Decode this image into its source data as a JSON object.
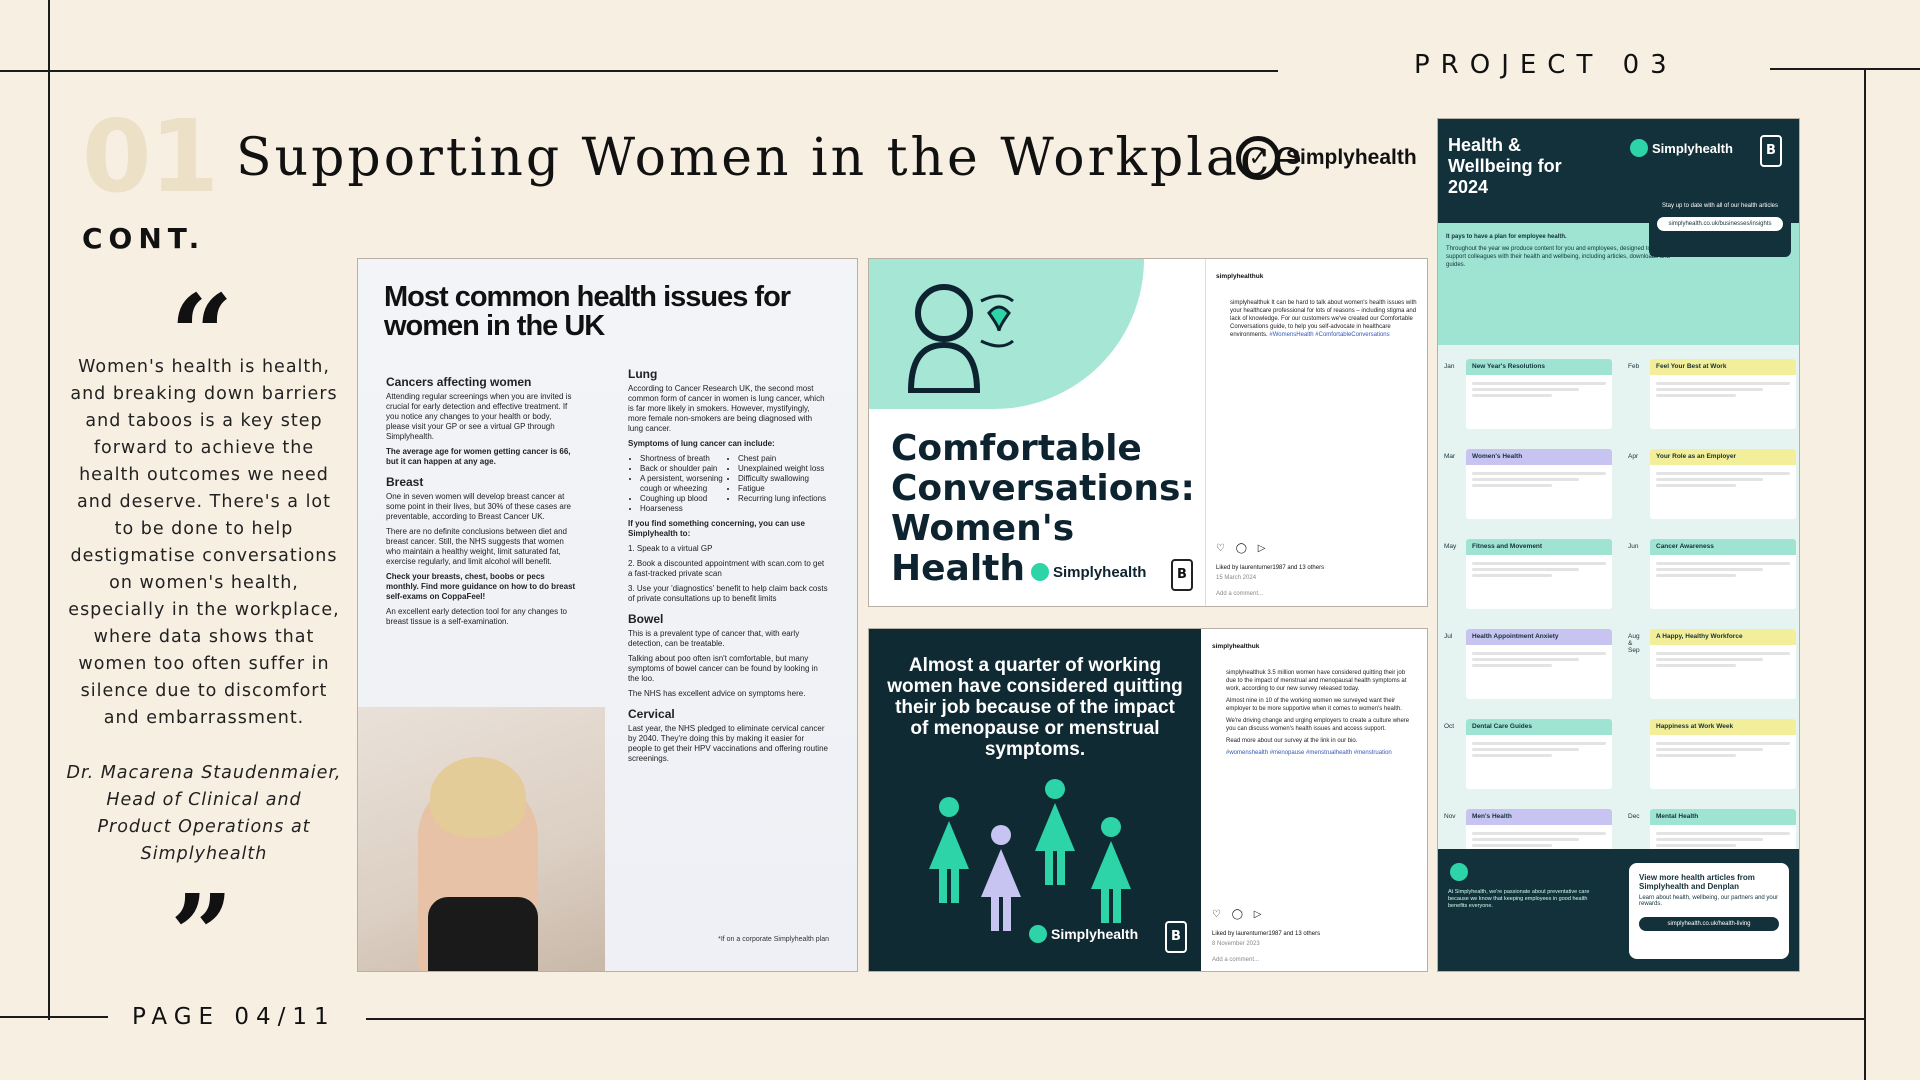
{
  "header": {
    "project_label": "PROJECT 03",
    "section_number": "01",
    "title": "Supporting Women in the Workplace",
    "cont_label": "CONT.",
    "brand": "Simplyhealth"
  },
  "quote": {
    "open_mark": "“",
    "close_mark": "”",
    "text": "Women's health is health, and breaking down barriers and taboos is a key step forward to achieve the health outcomes we need and deserve. There's a lot to be done to help destigmatise conversations on women's health, especially in the workplace, where data shows that women too often suffer in silence due to discomfort and embarrassment.",
    "attribution": "Dr. Macarena Staudenmaier, Head of Clinical and Product Operations at Simplyhealth"
  },
  "footer": {
    "page_label": "PAGE 04/11"
  },
  "panel_health_issues": {
    "title": "Most common health issues for women in the UK",
    "col1": {
      "h_cancers": "Cancers affecting women",
      "p_cancers": "Attending regular screenings when you are invited is crucial for early detection and effective treatment. If you notice any changes to your health or body, please visit your GP or see a virtual GP through Simplyhealth.",
      "callout_1": "The average age for women getting cancer is 66, but it can happen at any age.",
      "h_breast": "Breast",
      "p_breast": "One in seven women will develop breast cancer at some point in their lives, but 30% of these cases are preventable, according to Breast Cancer UK.",
      "callout_2": "There are no definite conclusions between diet and breast cancer. Still, the NHS suggests that women who maintain a healthy weight, limit saturated fat, exercise regularly, and limit alcohol will benefit.",
      "p_check": "Check your breasts, chest, boobs or pecs monthly. Find more guidance on how to do breast self-exams on CoppaFeel!",
      "p_tool": "An excellent early detection tool for any changes to breast tissue is a self-examination."
    },
    "col2": {
      "h_lung": "Lung",
      "p_lung": "According to Cancer Research UK, the second most common form of cancer in women is lung cancer, which is far more likely in smokers. However, mystifyingly, more female non-smokers are being diagnosed with lung cancer.",
      "h_symptoms": "Symptoms of lung cancer can include:",
      "symptoms": [
        "Shortness of breath",
        "Back or shoulder pain",
        "A persistent, worsening cough or wheezing",
        "Coughing up blood",
        "Hoarseness",
        "Chest pain",
        "Unexplained weight loss",
        "Difficulty swallowing",
        "Fatigue",
        "Recurring lung infections"
      ],
      "h_concern": "If you find something concerning, you can use Simplyhealth to:",
      "steps": [
        "1. Speak to a virtual GP",
        "2. Book a discounted appointment with scan.com to get a fast-tracked private scan",
        "3. Use your 'diagnostics' benefit to help claim back costs of private consultations up to benefit limits"
      ],
      "h_bowel": "Bowel",
      "p_bowel": "This is a prevalent type of cancer that, with early detection, can be treatable.",
      "p_bowel2": "Talking about poo often isn't comfortable, but many symptoms of bowel cancer can be found by looking in the loo.",
      "p_nhs": "The NHS has excellent advice on symptoms here.",
      "h_cervical": "Cervical",
      "p_cervical": "Last year, the NHS pledged to eliminate cervical cancer by 2040. They're doing this by making it easier for people to get their HPV vaccinations and offering routine screenings."
    },
    "footnote": "*If on a corporate Simplyhealth plan"
  },
  "panel_conversations": {
    "headline_1": "Comfortable",
    "headline_2": "Conversations:",
    "headline_3": "Women's",
    "headline_4": "Health",
    "brand": "Simplyhealth",
    "username": "simplyhealthuk",
    "caption": "simplyhealthuk It can be hard to talk about women's health issues with your healthcare professional for lots of reasons – including stigma and lack of knowledge. For our customers we've created our Comfortable Conversations guide, to help you self-advocate in healthcare environments.",
    "hashtags": "#WomensHealth #ComfortableConversations",
    "likes": "Liked by laurenturner1987 and 13 others",
    "date": "15 March 2024",
    "comment_placeholder": "Add a comment..."
  },
  "panel_quarter": {
    "headline": "Almost a quarter of working women have considered quitting their job because of the impact of menopause or menstrual symptoms.",
    "brand": "Simplyhealth",
    "username": "simplyhealthuk",
    "caption": "simplyhealthuk 3.5 million women have considered quitting their job due to the impact of menstrual and menopausal health symptoms at work, according to our new survey released today.",
    "caption_2": "Almost nine in 10 of the working women we surveyed want their employer to be more supportive when it comes to women's health.",
    "caption_3": "We're driving change and urging employers to create a culture where you can discuss women's health issues and access support.",
    "caption_4": "Read more about our survey at the link in our bio.",
    "hashtags": "#womenshealth #menopause #menstrualhealth #menstruation",
    "likes": "Liked by laurenturner1987 and 13 others",
    "date": "8 November 2023",
    "comment_placeholder": "Add a comment..."
  },
  "panel_calendar": {
    "title": "Health & Wellbeing for 2024",
    "brand": "Simplyhealth",
    "stay_text": "Stay up to date with all of our health articles",
    "stay_link": "simplyhealth.co.uk/businesses/insights",
    "intro_heading": "It pays to have a plan for employee health.",
    "intro": "Throughout the year we produce content for you and employees, designed to help you support colleagues with their health and wellbeing, including articles, downloads and guides.",
    "months": [
      {
        "m": "Jan",
        "title": "New Year's Resolutions",
        "color": "#9fe3d3"
      },
      {
        "m": "Feb",
        "title": "Feel Your Best at Work",
        "color": "#f3ee9a"
      },
      {
        "m": "Mar",
        "title": "Women's Health",
        "color": "#c8c4f2"
      },
      {
        "m": "Apr",
        "title": "Your Role as an Employer",
        "color": "#f3ee9a"
      },
      {
        "m": "May",
        "title": "Fitness and Movement",
        "color": "#9fe3d3"
      },
      {
        "m": "Jun",
        "title": "Cancer Awareness",
        "color": "#9fe3d3"
      },
      {
        "m": "Jul",
        "title": "Health Appointment Anxiety",
        "color": "#c8c4f2"
      },
      {
        "m": "Aug & Sep",
        "title": "A Happy, Healthy Workforce",
        "color": "#f3ee9a"
      },
      {
        "m": "Oct",
        "title": "Dental Care Guides",
        "color": "#9fe3d3"
      },
      {
        "m": "",
        "title": "Happiness at Work Week",
        "color": "#f3ee9a"
      },
      {
        "m": "Nov",
        "title": "Men's Health",
        "color": "#c8c4f2"
      },
      {
        "m": "Dec",
        "title": "Mental Health",
        "color": "#9fe3d3"
      }
    ],
    "view_more": "View more health articles from Simplyhealth and Denplan",
    "view_sub": "Learn about health, wellbeing, our partners and your rewards.",
    "view_link": "simplyhealth.co.uk/health-living",
    "bottom_text": "At Simplyhealth, we're passionate about preventative care because we know that keeping employees in good health benefits everyone."
  }
}
